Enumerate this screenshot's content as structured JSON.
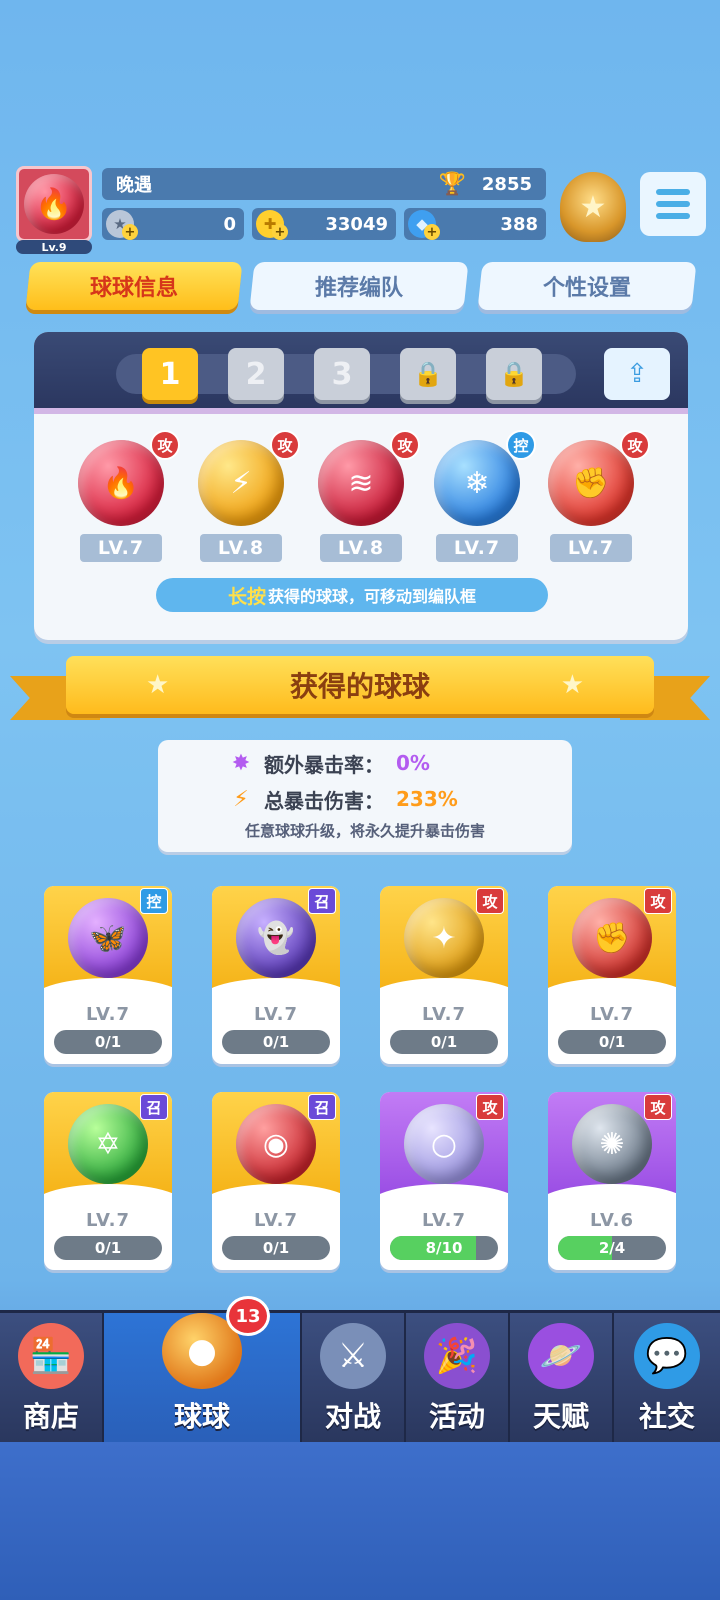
{
  "player": {
    "name": "晚遇",
    "level": "Lv.9",
    "trophies": "2855",
    "silver": "0",
    "gold": "33049",
    "gems": "388"
  },
  "tabs": [
    "球球信息",
    "推荐编队",
    "个性设置"
  ],
  "formation": {
    "slots": [
      "1",
      "2",
      "3"
    ],
    "team": [
      {
        "tag": "攻",
        "level": "LV.7",
        "icon": "fire-orb-icon"
      },
      {
        "tag": "攻",
        "level": "LV.8",
        "icon": "lightning-orb-icon"
      },
      {
        "tag": "攻",
        "level": "LV.8",
        "icon": "claw-orb-icon"
      },
      {
        "tag": "控",
        "level": "LV.7",
        "icon": "ice-orb-icon"
      },
      {
        "tag": "攻",
        "level": "LV.7",
        "icon": "fist-orb-icon"
      }
    ],
    "hint_emphasis": "长按",
    "hint_text": "获得的球球，可移动到编队框"
  },
  "section_title": "获得的球球",
  "crit": {
    "extra_rate_label": "额外暴击率：",
    "extra_rate_value": "0%",
    "total_damage_label": "总暴击伤害：",
    "total_damage_value": "233%",
    "note": "任意球球升级，将永久提升暴击伤害"
  },
  "balls": [
    {
      "tag": "控",
      "level": "LV.7",
      "progress": "0/1",
      "fraction": 0,
      "frame": "gold",
      "icon": "butterfly-orb-icon"
    },
    {
      "tag": "召",
      "level": "LV.7",
      "progress": "0/1",
      "fraction": 0,
      "frame": "gold",
      "icon": "ghost-orb-icon"
    },
    {
      "tag": "攻",
      "level": "LV.7",
      "progress": "0/1",
      "fraction": 0,
      "frame": "gold",
      "icon": "blade-orb-icon"
    },
    {
      "tag": "攻",
      "level": "LV.7",
      "progress": "0/1",
      "fraction": 0,
      "frame": "gold",
      "icon": "fist-orb-icon"
    },
    {
      "tag": "召",
      "level": "LV.7",
      "progress": "0/1",
      "fraction": 0,
      "frame": "gold",
      "icon": "star-orb-icon"
    },
    {
      "tag": "召",
      "level": "LV.7",
      "progress": "0/1",
      "fraction": 0,
      "frame": "gold",
      "icon": "cannon-orb-icon"
    },
    {
      "tag": "攻",
      "level": "LV.7",
      "progress": "8/10",
      "fraction": 0.8,
      "frame": "purple",
      "icon": "bubble-orb-icon"
    },
    {
      "tag": "攻",
      "level": "LV.6",
      "progress": "2/4",
      "fraction": 0.5,
      "frame": "purple",
      "icon": "vortex-orb-icon"
    }
  ],
  "nav": {
    "badge": "13",
    "items": [
      "商店",
      "球球",
      "对战",
      "活动",
      "天赋",
      "社交"
    ]
  },
  "colors": {
    "accent_gold": "#ffc423",
    "attack_tag": "#d93b3b",
    "control_tag": "#2f9be6",
    "summon_tag": "#6a4ad8",
    "progress_fill": "#57d060"
  }
}
